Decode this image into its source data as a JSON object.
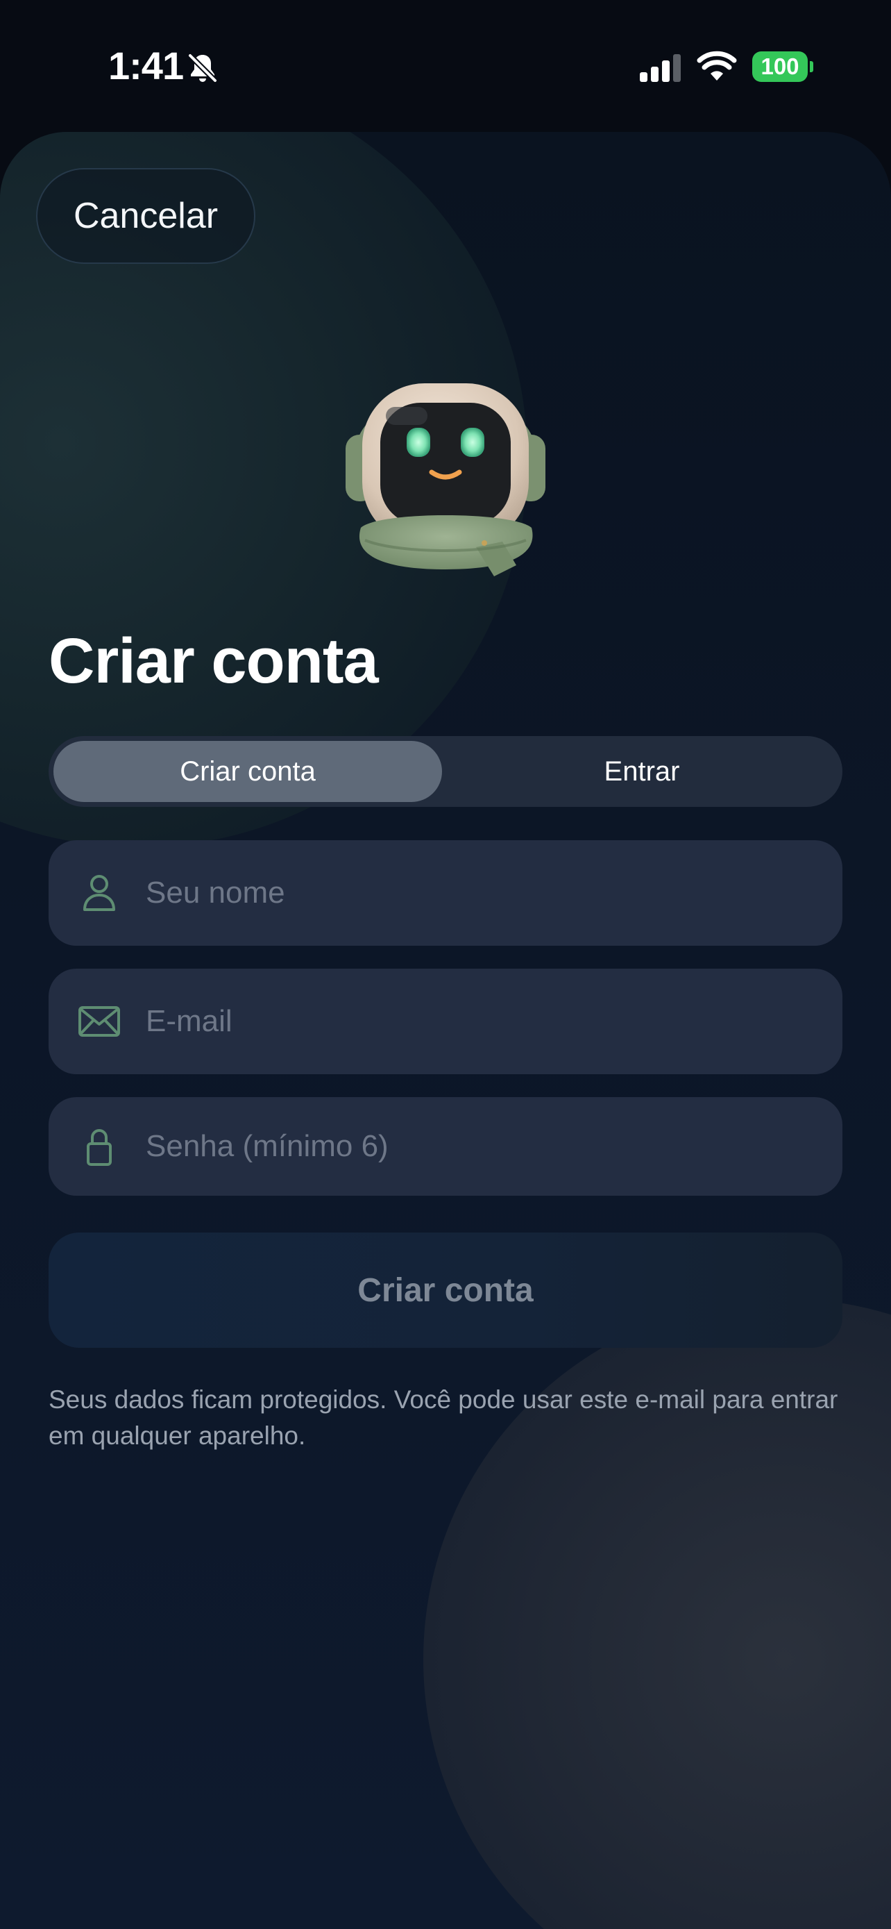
{
  "status_bar": {
    "time": "1:41",
    "battery": "100",
    "icons": [
      "bell-slash-icon",
      "signal-icon",
      "wifi-icon",
      "battery-icon"
    ],
    "battery_color": "#34c759"
  },
  "header": {
    "cancel_label": "Cancelar"
  },
  "mascot": {
    "icon": "robot-mascot-icon"
  },
  "page": {
    "title": "Criar conta"
  },
  "tabs": [
    {
      "label": "Criar conta",
      "active": true
    },
    {
      "label": "Entrar",
      "active": false
    }
  ],
  "form": {
    "name": {
      "placeholder": "Seu nome",
      "value": "",
      "icon": "person-icon"
    },
    "email": {
      "placeholder": "E-mail",
      "value": "",
      "icon": "envelope-icon"
    },
    "password": {
      "placeholder": "Senha (mínimo 6)",
      "value": "",
      "icon": "lock-icon"
    },
    "submit_label": "Criar conta",
    "icon_color": "#5e8d72"
  },
  "footnote": "Seus dados ficam protegidos. Você pode usar este e-mail para entrar em qualquer aparelho."
}
